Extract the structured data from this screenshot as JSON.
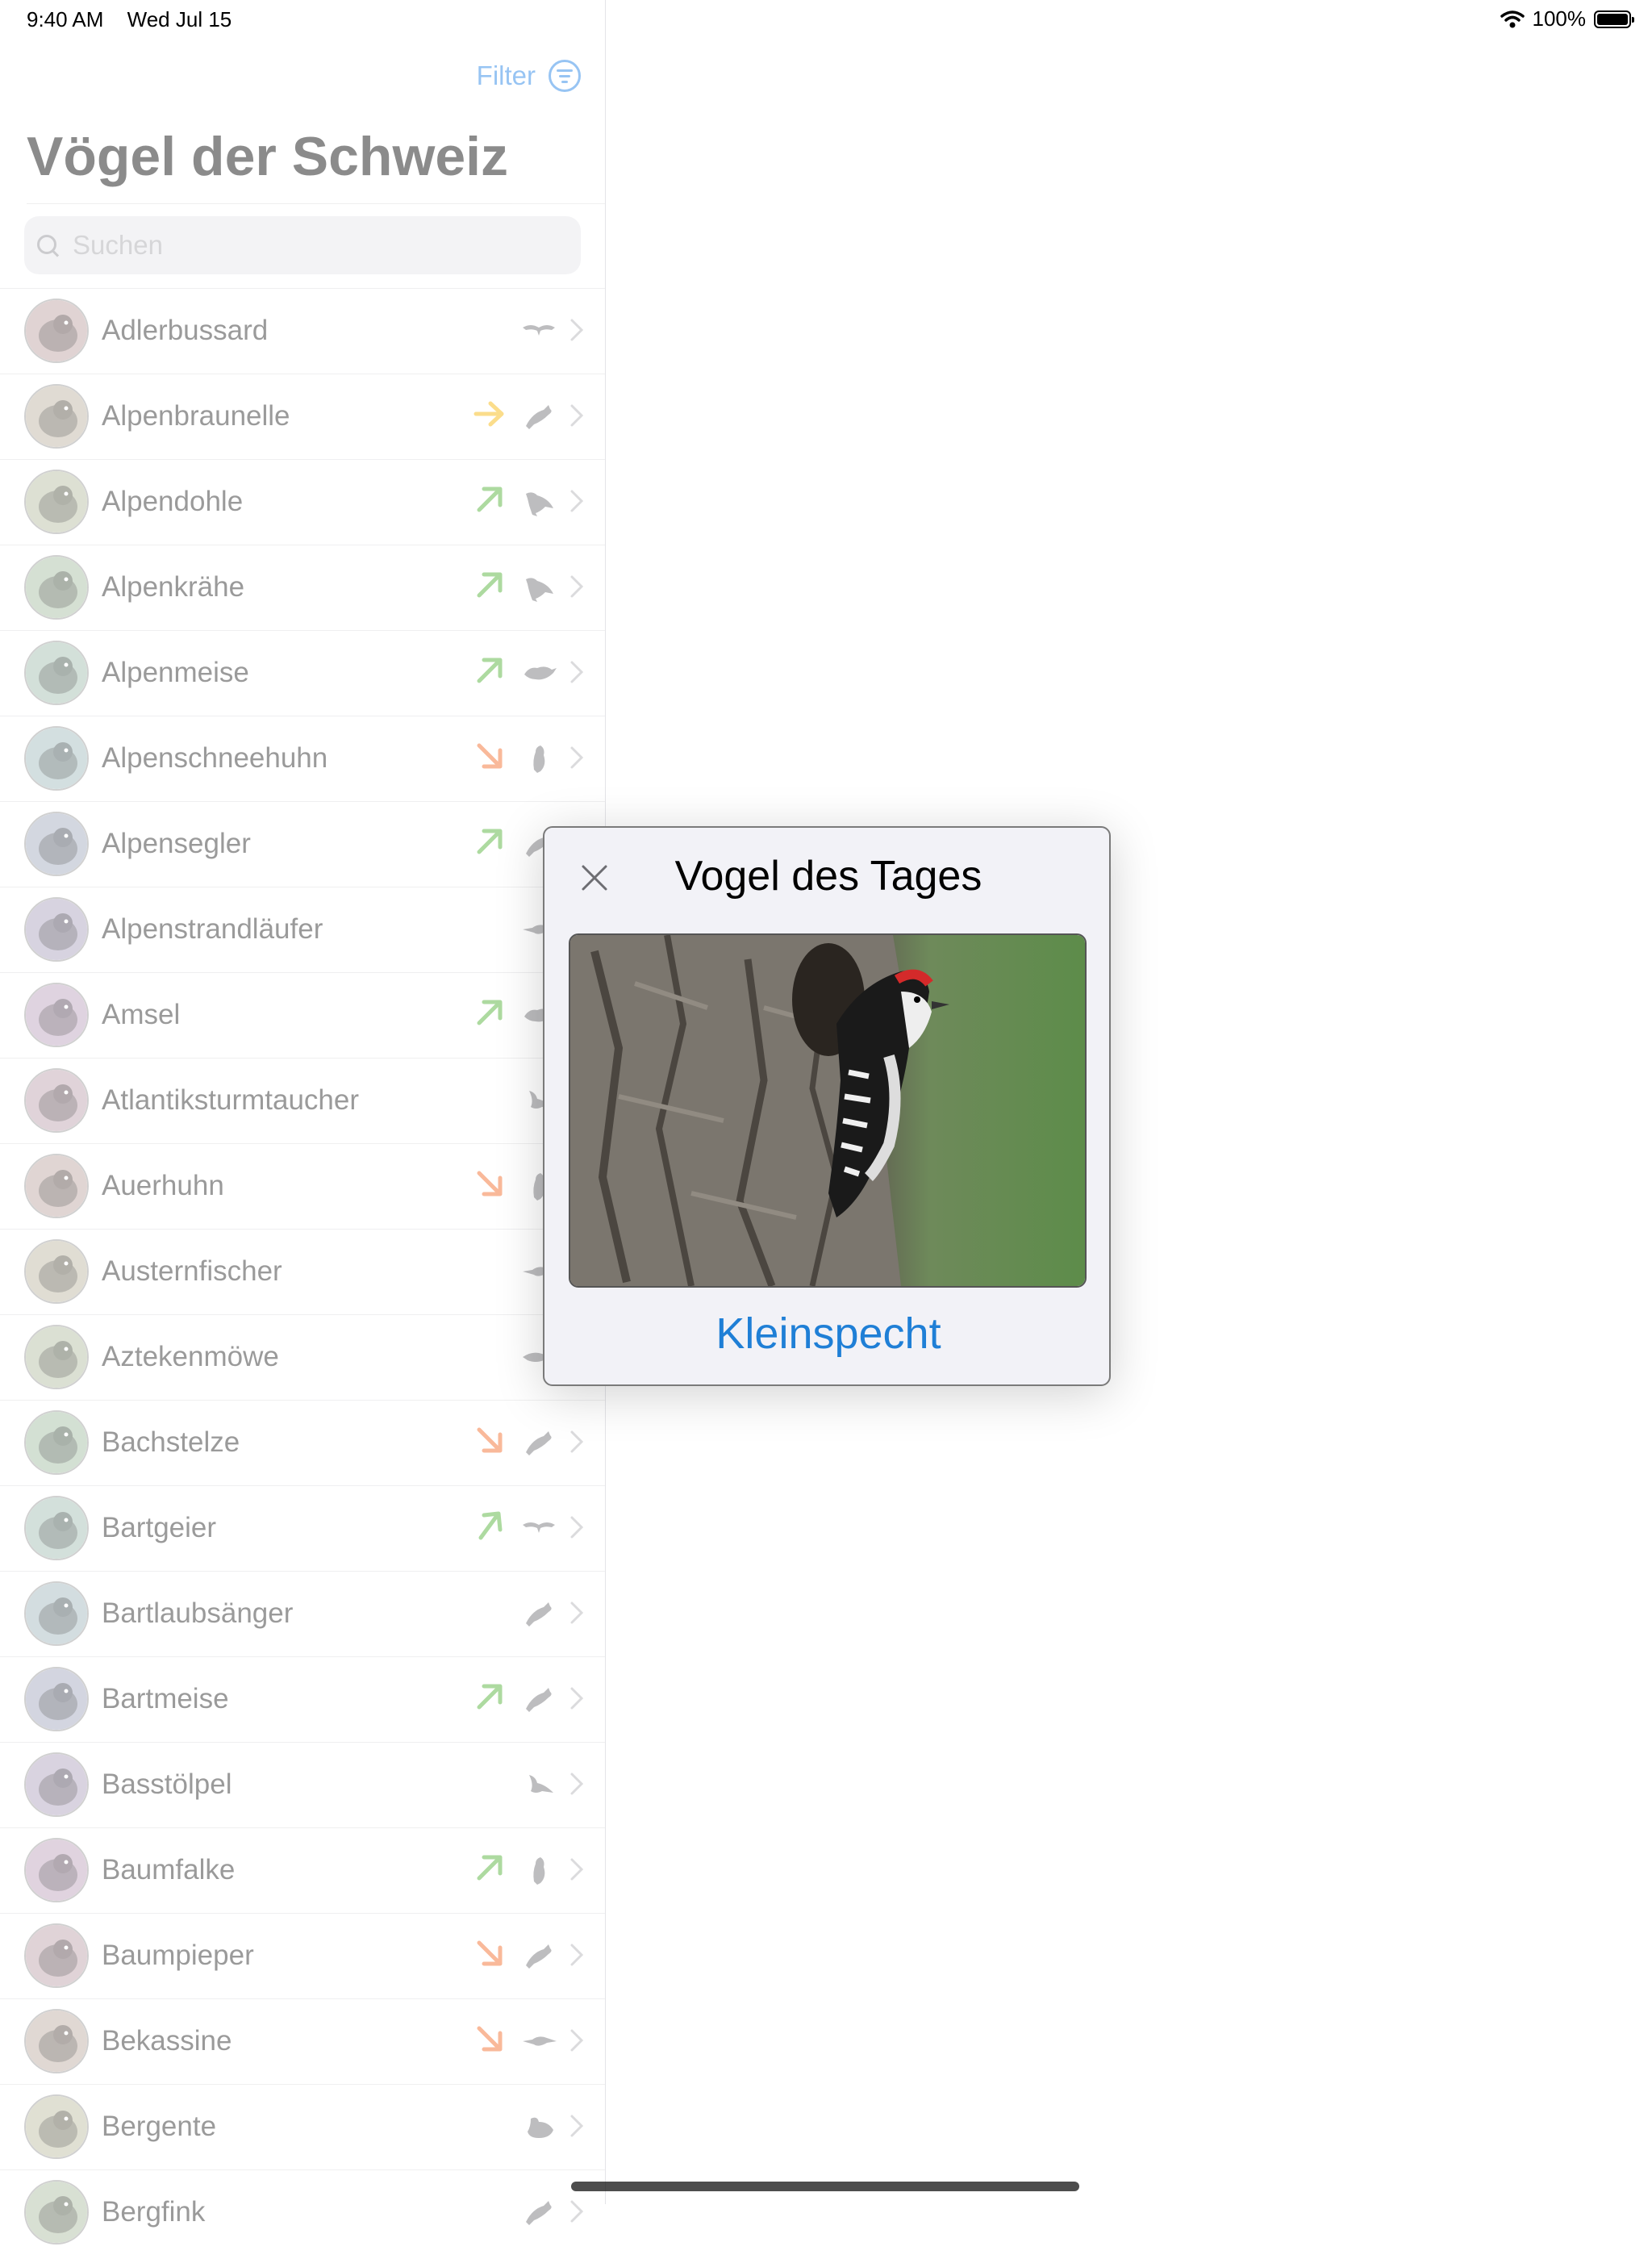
{
  "status_bar": {
    "time": "9:40 AM",
    "date": "Wed Jul 15",
    "battery": "100%"
  },
  "master": {
    "filter_label": "Filter",
    "title": "Vögel der Schweiz",
    "search_placeholder": "Suchen",
    "birds": [
      {
        "name": "Adlerbussard",
        "trend": "none",
        "silhouette": "raptor-soaring"
      },
      {
        "name": "Alpenbraunelle",
        "trend": "stable",
        "silhouette": "perching"
      },
      {
        "name": "Alpendohle",
        "trend": "up",
        "silhouette": "corvid"
      },
      {
        "name": "Alpenkrähe",
        "trend": "up",
        "silhouette": "corvid"
      },
      {
        "name": "Alpenmeise",
        "trend": "up",
        "silhouette": "songbird"
      },
      {
        "name": "Alpenschneehuhn",
        "trend": "down",
        "silhouette": "upright"
      },
      {
        "name": "Alpensegler",
        "trend": "up",
        "silhouette": "perching"
      },
      {
        "name": "Alpenstrandläufer",
        "trend": "none",
        "silhouette": "wader"
      },
      {
        "name": "Amsel",
        "trend": "up",
        "silhouette": "songbird"
      },
      {
        "name": "Atlantiksturmtaucher",
        "trend": "none",
        "silhouette": "seabird"
      },
      {
        "name": "Auerhuhn",
        "trend": "down",
        "silhouette": "upright"
      },
      {
        "name": "Austernfischer",
        "trend": "none",
        "silhouette": "wader"
      },
      {
        "name": "Aztekenmöwe",
        "trend": "none",
        "silhouette": "gull"
      },
      {
        "name": "Bachstelze",
        "trend": "down",
        "silhouette": "perching"
      },
      {
        "name": "Bartgeier",
        "trend": "strong-up",
        "silhouette": "raptor-soaring"
      },
      {
        "name": "Bartlaubsänger",
        "trend": "none",
        "silhouette": "perching"
      },
      {
        "name": "Bartmeise",
        "trend": "up",
        "silhouette": "perching"
      },
      {
        "name": "Basstölpel",
        "trend": "none",
        "silhouette": "seabird"
      },
      {
        "name": "Baumfalke",
        "trend": "up",
        "silhouette": "upright"
      },
      {
        "name": "Baumpieper",
        "trend": "down",
        "silhouette": "perching"
      },
      {
        "name": "Bekassine",
        "trend": "down",
        "silhouette": "wader"
      },
      {
        "name": "Bergente",
        "trend": "none",
        "silhouette": "duck"
      },
      {
        "name": "Bergfink",
        "trend": "none",
        "silhouette": "perching"
      }
    ]
  },
  "popup": {
    "title": "Vogel des Tages",
    "bird_name": "Kleinspecht",
    "image_icon": "woodpecker-photo"
  },
  "colors": {
    "accent": "#1a7ee6",
    "trend_up": "#4caf2e",
    "trend_stable": "#f7b500",
    "trend_down": "#f26522"
  }
}
